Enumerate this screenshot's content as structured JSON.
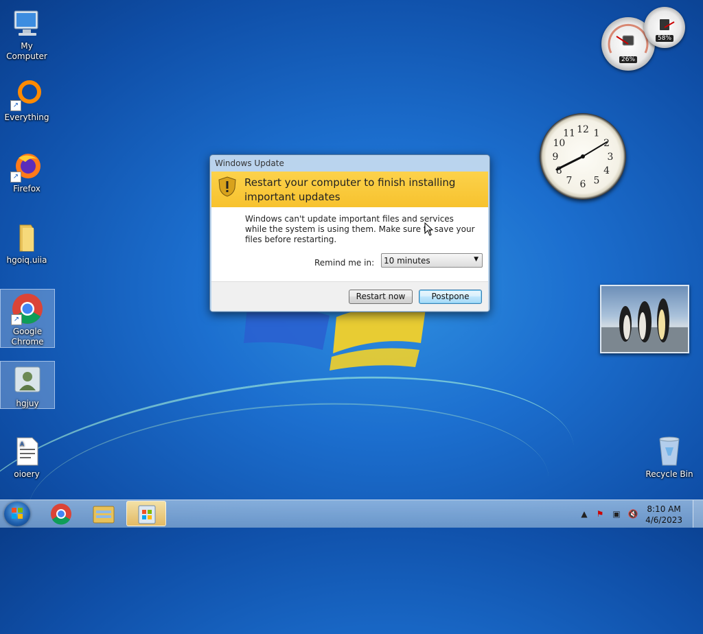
{
  "desktop": {
    "icons": [
      {
        "label": "My Computer",
        "icon": "computer-icon"
      },
      {
        "label": "Everything",
        "icon": "everything-icon"
      },
      {
        "label": "Firefox",
        "icon": "firefox-icon"
      },
      {
        "label": "hgoiq.uiia",
        "icon": "folder-icon"
      },
      {
        "label": "Google Chrome",
        "icon": "chrome-icon"
      },
      {
        "label": "hgjuy",
        "icon": "user-icon"
      },
      {
        "label": "oioery",
        "icon": "document-icon"
      },
      {
        "label": "Recycle Bin",
        "icon": "recycle-bin-icon"
      }
    ]
  },
  "gadgets": {
    "cpu_percent": "26%",
    "memory_percent": "58%",
    "clock_numbers": [
      "12",
      "1",
      "2",
      "3",
      "4",
      "5",
      "6",
      "7",
      "8",
      "9",
      "10",
      "11"
    ]
  },
  "dialog": {
    "title": "Windows Update",
    "headline": "Restart your computer to finish installing important updates",
    "message": "Windows can't update important files and services while the system is using them. Make sure to save your files before restarting.",
    "remind_label": "Remind me in:",
    "remind_value": "10 minutes",
    "restart_label": "Restart now",
    "postpone_label": "Postpone"
  },
  "taskbar": {
    "time": "8:10 AM",
    "date": "4/6/2023"
  },
  "colors": {
    "banner": "#f7c22e",
    "desktop": "#1c6fcf"
  }
}
